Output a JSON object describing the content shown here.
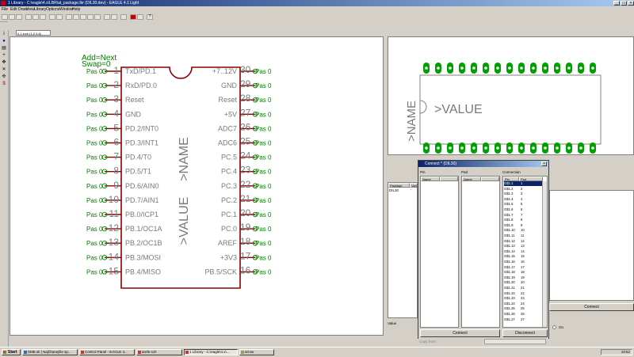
{
  "window": {
    "title": "1 Library - C:\\eagle\\4.x\\LBR\\at_package.lbr (DIL30.dev) - EAGLE 4.1 Light"
  },
  "menu": [
    "File",
    "Edit",
    "Draw",
    "View",
    "Library",
    "Options",
    "Window",
    "Help"
  ],
  "coord_readout": "0.1 inch (1.2 0.6)",
  "symbol": {
    "attrs": [
      "Add=Next",
      "Swap=0"
    ],
    "name": ">NAME",
    "value": ">VALUE",
    "pas_label": "Pas 0",
    "left_pins": [
      {
        "num": "1",
        "label": "TxD/PD.1"
      },
      {
        "num": "2",
        "label": "RxD/PD.0"
      },
      {
        "num": "3",
        "label": "Reset"
      },
      {
        "num": "4",
        "label": "GND"
      },
      {
        "num": "5",
        "label": "PD.2/INT0"
      },
      {
        "num": "6",
        "label": "PD.3/INT1"
      },
      {
        "num": "7",
        "label": "PD.4/T0"
      },
      {
        "num": "8",
        "label": "PD.5/T1"
      },
      {
        "num": "9",
        "label": "PD.6/AIN0"
      },
      {
        "num": "10",
        "label": "PD.7/AIN1"
      },
      {
        "num": "11",
        "label": "PB.0/ICP1"
      },
      {
        "num": "12",
        "label": "PB.1/OC1A"
      },
      {
        "num": "13",
        "label": "PB.2/OC1B"
      },
      {
        "num": "14",
        "label": "PB.3/MOSI"
      },
      {
        "num": "15",
        "label": "PB.4/MISO"
      }
    ],
    "right_pins": [
      {
        "num": "30",
        "label": "+7..12V"
      },
      {
        "num": "29",
        "label": "GND"
      },
      {
        "num": "28",
        "label": "Reset"
      },
      {
        "num": "27",
        "label": "+5V"
      },
      {
        "num": "26",
        "label": "ADC7"
      },
      {
        "num": "25",
        "label": "ADC6"
      },
      {
        "num": "24",
        "label": "PC.5"
      },
      {
        "num": "23",
        "label": "PC.4"
      },
      {
        "num": "22",
        "label": "PC.3"
      },
      {
        "num": "21",
        "label": "PC.2"
      },
      {
        "num": "20",
        "label": "PC.1"
      },
      {
        "num": "19",
        "label": "PC.0"
      },
      {
        "num": "18",
        "label": "AREF"
      },
      {
        "num": "17",
        "label": "+3V3"
      },
      {
        "num": "16",
        "label": "PB.5/SCK"
      }
    ]
  },
  "package_preview": {
    "name": ">NAME",
    "value": ">VALUE",
    "pad_count_per_row": 15
  },
  "package_list": {
    "headers": [
      "Package",
      "Vari"
    ],
    "row": [
      "DIL30",
      "'"
    ],
    "value_label": "Value"
  },
  "connect_dialog": {
    "title": "Connect * (DIL30)",
    "col_pin": "Pin",
    "col_pad": "Pad",
    "col_connection": "Connection",
    "hdr_name": "Name",
    "hdr_pin": "Pin",
    "hdr_pad": "Pad",
    "connections": [
      [
        "G$1.1",
        "1"
      ],
      [
        "G$1.2",
        "2"
      ],
      [
        "G$1.3",
        "3"
      ],
      [
        "G$1.4",
        "4"
      ],
      [
        "G$1.5",
        "5"
      ],
      [
        "G$1.6",
        "6"
      ],
      [
        "G$1.7",
        "7"
      ],
      [
        "G$1.8",
        "8"
      ],
      [
        "G$1.9",
        "9"
      ],
      [
        "G$1.10",
        "10"
      ],
      [
        "G$1.11",
        "11"
      ],
      [
        "G$1.12",
        "12"
      ],
      [
        "G$1.13",
        "13"
      ],
      [
        "G$1.14",
        "14"
      ],
      [
        "G$1.15",
        "15"
      ],
      [
        "G$1.16",
        "16"
      ],
      [
        "G$1.17",
        "17"
      ],
      [
        "G$1.18",
        "18"
      ],
      [
        "G$1.19",
        "19"
      ],
      [
        "G$1.20",
        "20"
      ],
      [
        "G$1.21",
        "21"
      ],
      [
        "G$1.22",
        "22"
      ],
      [
        "G$1.23",
        "23"
      ],
      [
        "G$1.24",
        "24"
      ],
      [
        "G$1.25",
        "25"
      ],
      [
        "G$1.26",
        "26"
      ],
      [
        "G$1.27",
        "27"
      ]
    ],
    "connect_button": "Connect",
    "disconnect_button": "Disconnect",
    "copy_from": "Copy from:",
    "side_connect_button": "Connect",
    "on_label": "On"
  },
  "taskbar": {
    "start": "Start",
    "tasks": [
      "SME.sk | Najčítanejšie sp...",
      "Control Panel - EAGLE 4...",
      "arefe.sch",
      "1 Library - C:\\eagle\\4.x\\...",
      "arrow"
    ],
    "clock": "19:52"
  },
  "colors": {
    "symbol_line": "#8b0000",
    "pin_text": "#7a7a7a",
    "attr_green": "#008000",
    "pad_green": "#00a000"
  }
}
